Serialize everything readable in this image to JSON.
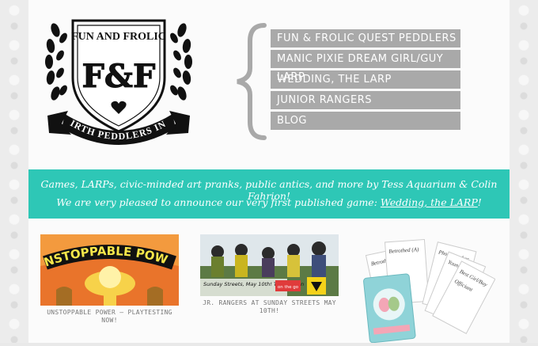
{
  "logo": {
    "top_text": "FUN AND FROLIC",
    "monogram": "F&F",
    "ribbon_text": "MIRTH PEDDLERS INC."
  },
  "nav": {
    "items": [
      {
        "label": "FUN & FROLIC QUEST PEDDLERS"
      },
      {
        "label": "MANIC PIXIE DREAM GIRL/GUY LARP"
      },
      {
        "label": "WEDDING, THE LARP"
      },
      {
        "label": "JUNIOR RANGERS"
      },
      {
        "label": "BLOG"
      }
    ]
  },
  "banner": {
    "line1": "Games, LARPs, civic-minded art pranks, public antics, and more by Tess Aquarium & Colin Fahrion!",
    "line2_prefix": "We are very pleased to announce our very first published game: ",
    "line2_link": "Wedding, the LARP",
    "line2_suffix": "!"
  },
  "cards": [
    {
      "image_text": "UNSTOPPABLE POWER",
      "caption": "UNSTOPPABLE POWER — PLAYTESTING NOW!"
    },
    {
      "image_text": "Sunday Streets, May 10th! The Mission",
      "badge": "on the go",
      "caption": "JR. RANGERS AT SUNDAY STREETS MAY 10TH!"
    },
    {
      "image_text": "Betrothed (A)",
      "card_texts": [
        "Betrothed (A)",
        "Photographer",
        "Younger Sibling",
        "Best Girl/Boy",
        "Officiant"
      ]
    }
  ],
  "colors": {
    "teal": "#2ec7b6",
    "nav_bg": "#a9a9a9",
    "orange": "#e9742b"
  }
}
